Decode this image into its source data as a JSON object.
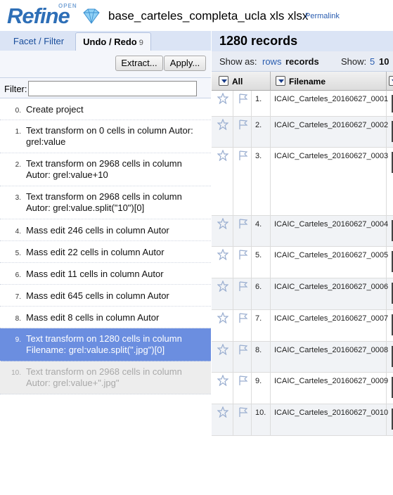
{
  "header": {
    "logo_open": "OPEN",
    "logo_refine": "Refine",
    "project_title": "base_carteles_completa_ucla xls xlsx",
    "permalink": "Permalink"
  },
  "left_tabs": {
    "facet_filter": "Facet / Filter",
    "undo_redo": "Undo / Redo",
    "undo_count": "9"
  },
  "undo_toolbar": {
    "extract": "Extract...",
    "apply": "Apply..."
  },
  "filter": {
    "label": "Filter:",
    "value": ""
  },
  "history": [
    {
      "num": "0.",
      "text": "Create project",
      "state": "done"
    },
    {
      "num": "1.",
      "text": "Text transform on 0 cells in column Autor: grel:value",
      "state": "done"
    },
    {
      "num": "2.",
      "text": "Text transform on 2968 cells in column Autor: grel:value+10",
      "state": "done"
    },
    {
      "num": "3.",
      "text": "Text transform on 2968 cells in column Autor: grel:value.split(\"10\")[0]",
      "state": "done"
    },
    {
      "num": "4.",
      "text": "Mass edit 246 cells in column Autor",
      "state": "done"
    },
    {
      "num": "5.",
      "text": "Mass edit 22 cells in column Autor",
      "state": "done"
    },
    {
      "num": "6.",
      "text": "Mass edit 11 cells in column Autor",
      "state": "done"
    },
    {
      "num": "7.",
      "text": "Mass edit 645 cells in column Autor",
      "state": "done"
    },
    {
      "num": "8.",
      "text": "Mass edit 8 cells in column Autor",
      "state": "done"
    },
    {
      "num": "9.",
      "text": "Text transform on 1280 cells in column Filename: grel:value.split(\".jpg\")[0]",
      "state": "current"
    },
    {
      "num": "10.",
      "text": "Text transform on 2968 cells in column Autor: grel:value+\".jpg\"",
      "state": "redo"
    }
  ],
  "summary": {
    "records": "1280 records"
  },
  "viewbar": {
    "show_as": "Show as:",
    "rows": "rows",
    "records": "records",
    "show": "Show:",
    "opt5": "5",
    "opt10": "10"
  },
  "grid": {
    "col_all": "All",
    "col_filename": "Filename",
    "rows": [
      {
        "idx": "1.",
        "filename": "ICAIC_Carteles_20160627_0001"
      },
      {
        "idx": "2.",
        "filename": "ICAIC_Carteles_20160627_0002"
      },
      {
        "idx": "3.",
        "filename": "ICAIC_Carteles_20160627_0003"
      },
      {
        "idx": "4.",
        "filename": "ICAIC_Carteles_20160627_0004"
      },
      {
        "idx": "5.",
        "filename": "ICAIC_Carteles_20160627_0005"
      },
      {
        "idx": "6.",
        "filename": "ICAIC_Carteles_20160627_0006"
      },
      {
        "idx": "7.",
        "filename": "ICAIC_Carteles_20160627_0007"
      },
      {
        "idx": "8.",
        "filename": "ICAIC_Carteles_20160627_0008"
      },
      {
        "idx": "9.",
        "filename": "ICAIC_Carteles_20160627_0009"
      },
      {
        "idx": "10.",
        "filename": "ICAIC_Carteles_20160627_0010"
      }
    ]
  },
  "colors": {
    "brand_blue": "#2e6fb7",
    "panel_bg": "#dbe4f5",
    "current_step": "#6b8ee0",
    "link": "#2a5db0"
  },
  "icons": {
    "logo": "diamond-icon",
    "star": "star-icon",
    "flag": "flag-icon",
    "dropdown": "dropdown-arrow-icon"
  }
}
